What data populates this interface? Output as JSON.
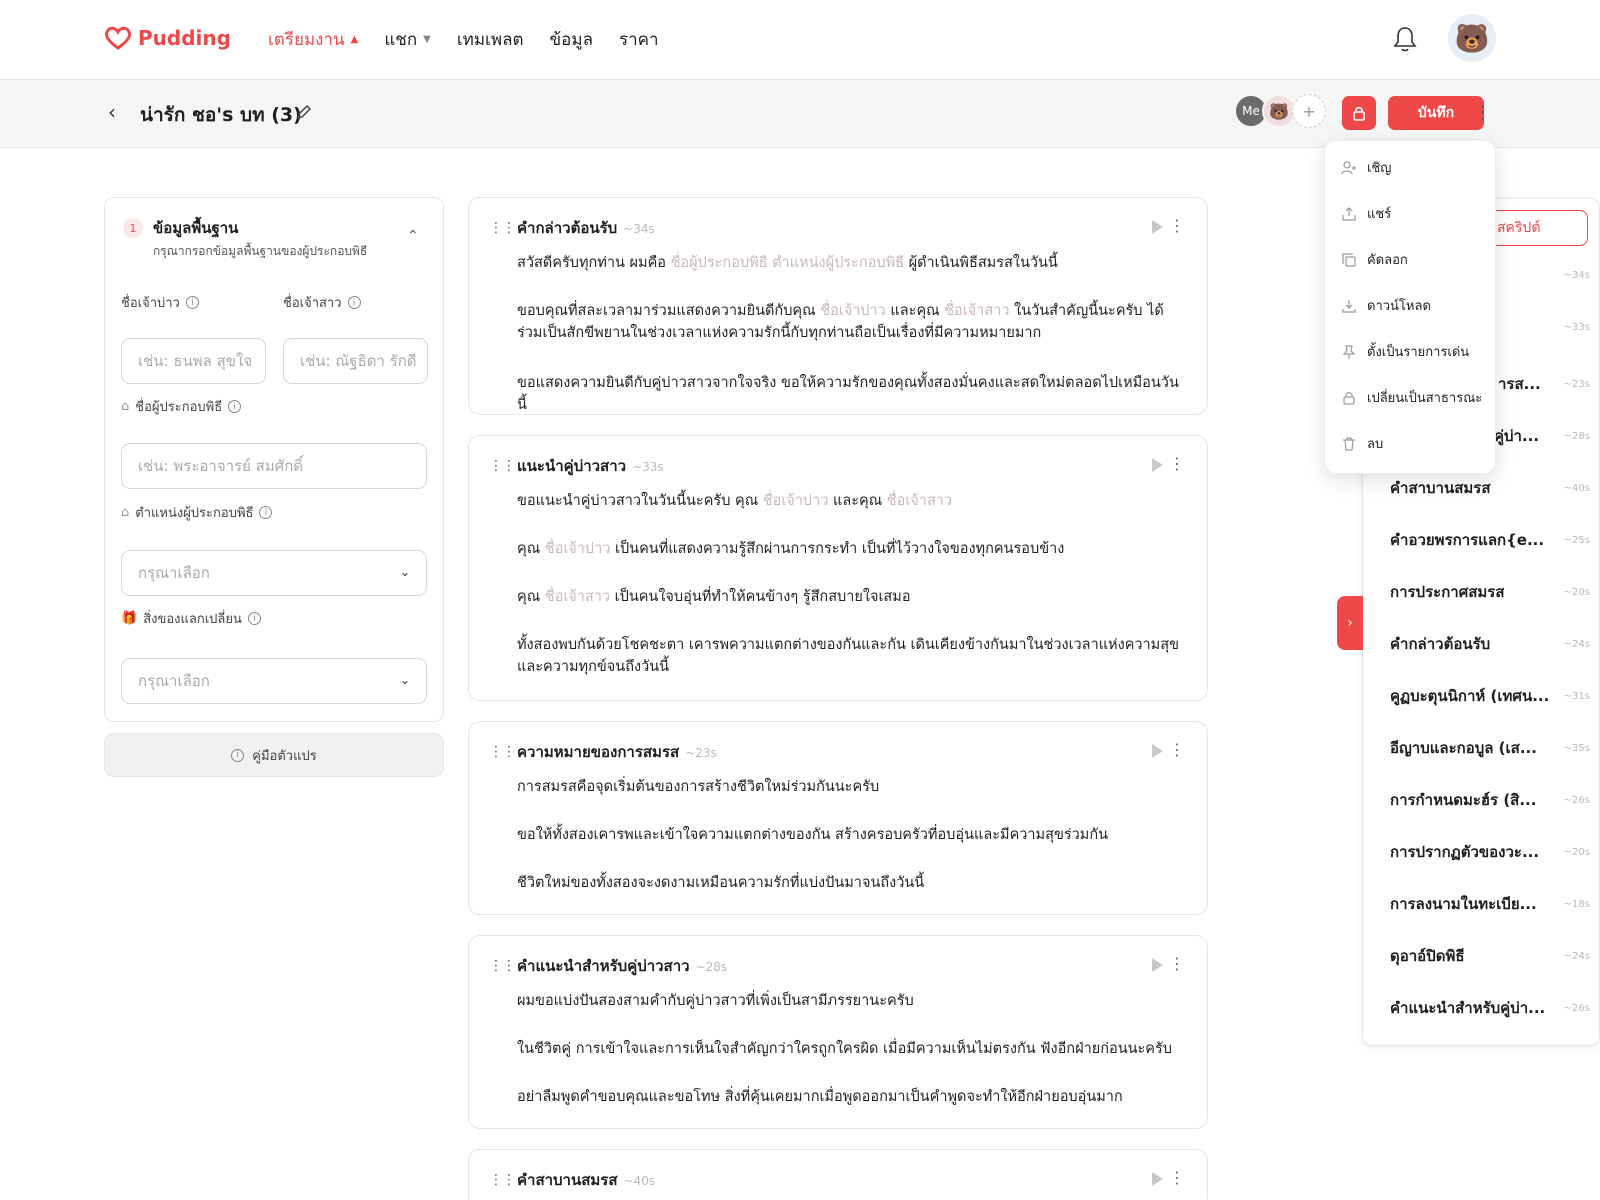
{
  "brand": {
    "name": "Pudding",
    "color": "#ef4848"
  },
  "nav": {
    "items": [
      {
        "label": "เตรียมงาน",
        "active": true,
        "chevron": "up"
      },
      {
        "label": "แชก",
        "active": false,
        "chevron": "down"
      },
      {
        "label": "เทมเพลต",
        "active": false
      },
      {
        "label": "ข้อมูล",
        "active": false
      },
      {
        "label": "ราคา",
        "active": false
      }
    ]
  },
  "subheader": {
    "title": "น่ารัก ชอ's บท (3)",
    "collaborators": [
      "Me"
    ],
    "add_symbol": "+",
    "save_label": "บันทึก"
  },
  "left_panel": {
    "step_number": "1",
    "section_title": "ข้อมูลพื้นฐาน",
    "section_subtitle": "กรุณากรอกข้อมูลพื้นฐานของผู้ประกอบพิธี",
    "groom_label": "ชื่อเจ้าบ่าว",
    "bride_label": "ชื่อเจ้าสาว",
    "groom_placeholder": "เช่น: ธนพล สุขใจ",
    "bride_placeholder": "เช่น: ณัฐธิดา รักดี",
    "officiant_label": "ชื่อผู้ประกอบพิธี",
    "officiant_placeholder": "เช่น: พระอาจารย์ สมศักดิ์",
    "position_label": "ตำแหน่งผู้ประกอบพิธี",
    "position_value": "กรุณาเลือก",
    "gift_label": "สิ่งของแลกเปลี่ยน",
    "gift_value": "กรุณาเลือก",
    "guide_label": "คู่มือตัวแปร"
  },
  "cards": [
    {
      "title": "คำกล่าวต้อนรับ",
      "duration": "~34s",
      "p1_a": "สวัสดีครับทุกท่าน ผมคือ ",
      "p1_v1": "ชื่อผู้ประกอบพิธี",
      "p1_v2": "ตำแหน่งผู้ประกอบพิธี",
      "p1_b": " ผู้ดำเนินพิธีสมรสในวันนี้",
      "p2_a": "ขอบคุณที่สละเวลามาร่วมแสดงความยินดีกับคุณ ",
      "p2_v1": "ชื่อเจ้าบ่าว",
      "p2_b": " และคุณ ",
      "p2_v2": "ชื่อเจ้าสาว",
      "p2_c": " ในวันสำคัญนี้นะครับ ได้ร่วมเป็นสักขีพยานในช่วงเวลาแห่งความรักนี้กับทุกท่านถือเป็นเรื่องที่มีความหมายมาก",
      "p3": "ขอแสดงความยินดีกับคู่บ่าวสาวจากใจจริง ขอให้ความรักของคุณทั้งสองมั่นคงและสดใหม่ตลอดไปเหมือนวันนี้"
    },
    {
      "title": "แนะนำคู่บ่าวสาว",
      "duration": "~33s",
      "p1_a": "ขอแนะนำคู่บ่าวสาวในวันนี้นะครับ คุณ ",
      "p1_v1": "ชื่อเจ้าบ่าว",
      "p1_b": " และคุณ ",
      "p1_v2": "ชื่อเจ้าสาว",
      "p2_a": "คุณ ",
      "p2_v": "ชื่อเจ้าบ่าว",
      "p2_b": " เป็นคนที่แสดงความรู้สึกผ่านการกระทำ เป็นที่ไว้วางใจของทุกคนรอบข้าง",
      "p3_a": "คุณ ",
      "p3_v": "ชื่อเจ้าสาว",
      "p3_b": " เป็นคนใจบอุ่นที่ทำให้คนข้างๆ รู้สึกสบายใจเสมอ",
      "p4": "ทั้งสองพบกันด้วยโชคชะตา เคารพความแตกต่างของกันและกัน เดินเคียงข้างกันมาในช่วงเวลาแห่งความสุขและความทุกข์จนถึงวันนี้"
    },
    {
      "title": "ความหมายของการสมรส",
      "duration": "~23s",
      "p1": "การสมรสคือจุดเริ่มต้นของการสร้างชีวิตใหม่ร่วมกันนะครับ",
      "p2": "ขอให้ทั้งสองเคารพและเข้าใจความแตกต่างของกัน สร้างครอบครัวที่อบอุ่นและมีความสุขร่วมกัน",
      "p3": "ชีวิตใหม่ของทั้งสองจะงดงามเหมือนความรักที่แบ่งปันมาจนถึงวันนี้"
    },
    {
      "title": "คำแนะนำสำหรับคู่บ่าวสาว",
      "duration": "~28s",
      "p1": "ผมขอแบ่งปันสองสามคำกับคู่บ่าวสาวที่เพิ่งเป็นสามีภรรยานะครับ",
      "p2": "ในชีวิตคู่ การเข้าใจและการเห็นใจสำคัญกว่าใครถูกใครผิด เมื่อมีความเห็นไม่ตรงกัน ฟังอีกฝ่ายก่อนนะครับ",
      "p3": "อย่าลืมพูดคำขอบคุณและขอโทษ สิ่งที่คุ้นเคยมากเมื่อพูดออกมาเป็นคำพูดจะทำให้อีกฝ่ายอบอุ่นมาก"
    },
    {
      "title": "คำสาบานสมรส",
      "duration": "~40s"
    }
  ],
  "outline": {
    "script_button": "สคริปต์",
    "items": [
      {
        "label": "",
        "duration": "~34s"
      },
      {
        "label": "",
        "duration": "~33s"
      },
      {
        "label": "ความหมายของการสมรส",
        "duration": "~23s"
      },
      {
        "label": "คำแนะนำสำหรับคู่บ่าวสาว",
        "duration": "~28s"
      },
      {
        "label": "คำสาบานสมรส",
        "duration": "~40s"
      },
      {
        "label": "คำอวยพรการแลก{e...",
        "duration": "~25s"
      },
      {
        "label": "การประกาศสมรส",
        "duration": "~20s"
      },
      {
        "label": "คำกล่าวต้อนรับ",
        "duration": "~24s"
      },
      {
        "label": "คูฏบะตุนนิกาห์ (เทศน...",
        "duration": "~31s"
      },
      {
        "label": "อีญาบและกอบูล (เส...",
        "duration": "~35s"
      },
      {
        "label": "การกำหนดมะฮ์ร (สิ...",
        "duration": "~26s"
      },
      {
        "label": "การปรากฏตัวของวะ...",
        "duration": "~20s"
      },
      {
        "label": "การลงนามในทะเบีย...",
        "duration": "~18s"
      },
      {
        "label": "ดุอาอ์ปิดพิธี",
        "duration": "~24s"
      },
      {
        "label": "คำแนะนำสำหรับคู่บ่า...",
        "duration": "~26s"
      }
    ],
    "partial_3": "ารส...",
    "partial_4": "คู่บ่า..."
  },
  "menu": {
    "items": [
      {
        "label": "เชิญ",
        "icon": "user-plus-icon"
      },
      {
        "label": "แชร์",
        "icon": "share-icon"
      },
      {
        "label": "คัดลอก",
        "icon": "copy-icon"
      },
      {
        "label": "ดาวน์โหลด",
        "icon": "download-icon"
      },
      {
        "label": "ตั้งเป็นรายการเด่น",
        "icon": "pin-icon"
      },
      {
        "label": "เปลี่ยนเป็นสาธารณะ",
        "icon": "lock-icon"
      },
      {
        "label": "ลบ",
        "icon": "trash-icon"
      }
    ]
  }
}
